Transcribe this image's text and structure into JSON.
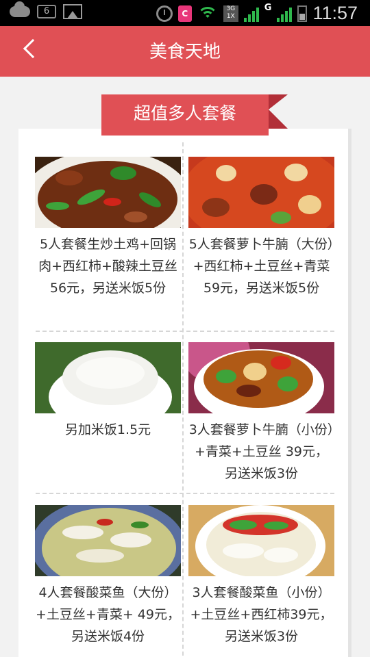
{
  "status_bar": {
    "notification_count": "6",
    "network_type": "3G",
    "network_subtype": "1X",
    "signal_label": "G",
    "time": "11:57"
  },
  "header": {
    "title": "美食天地",
    "back_icon": "chevron-left-icon"
  },
  "section": {
    "title": "超值多人套餐"
  },
  "items": [
    {
      "caption": "5人套餐生炒土鸡+回锅肉+西红柿+酸辣土豆丝 56元，另送米饭5份"
    },
    {
      "caption": "5人套餐萝卜牛腩（大份）+西红柿+土豆丝+青菜 59元，另送米饭5份"
    },
    {
      "caption": "另加米饭1.5元"
    },
    {
      "caption": "3人套餐萝卜牛腩（小份）+青菜+土豆丝 39元，另送米饭3份"
    },
    {
      "caption": "4人套餐酸菜鱼（大份）+土豆丝+青菜+ 49元，另送米饭4份"
    },
    {
      "caption": "3人套餐酸菜鱼（小份）+土豆丝+西红柿39元，另送米饭3份"
    }
  ],
  "colors": {
    "brand": "#e05055",
    "brand_dark": "#b22f38",
    "status_bar": "#000000",
    "text": "#333333"
  }
}
